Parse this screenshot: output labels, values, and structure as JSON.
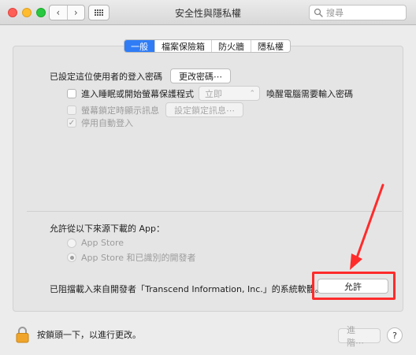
{
  "window": {
    "title": "安全性與隱私權"
  },
  "toolbar": {
    "back_glyph": "‹",
    "forward_glyph": "›",
    "search_placeholder": "搜尋"
  },
  "tabs": [
    {
      "label": "一般",
      "active": true
    },
    {
      "label": "檔案保險箱",
      "active": false
    },
    {
      "label": "防火牆",
      "active": false
    },
    {
      "label": "隱私權",
      "active": false
    }
  ],
  "general": {
    "password_label": "已設定這位使用者的登入密碼",
    "change_password_button": "更改密碼⋯",
    "require_password": {
      "label": "進入睡眠或開始螢幕保護程式",
      "select_value": "立即",
      "suffix": "喚醒電腦需要輸入密碼"
    },
    "lock_message": {
      "label": "螢幕鎖定時顯示訊息",
      "button": "設定鎖定訊息⋯"
    },
    "disable_autologin": {
      "label": "停用自動登入",
      "checked": true
    }
  },
  "downloads": {
    "heading": "允許從以下來源下載的 App：",
    "options": [
      {
        "label": "App Store",
        "selected": false
      },
      {
        "label": "App Store 和已識別的開發者",
        "selected": true
      }
    ],
    "blocked_message": "已阻擋載入來自開發者「Transcend Information, Inc.」的系統軟體。",
    "allow_button": "允許"
  },
  "footer": {
    "lock_text": "按鎖頭一下，以進行更改。",
    "advanced_button": "進階⋯",
    "help_glyph": "?"
  },
  "colors": {
    "accent": "#2f7cf6",
    "annotation": "#ff2b2b"
  }
}
